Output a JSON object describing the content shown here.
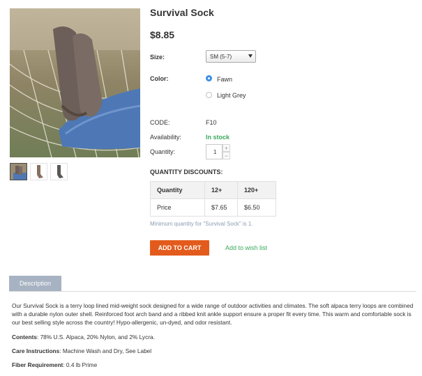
{
  "product": {
    "title": "Survival Sock",
    "price": "$8.85"
  },
  "images": {
    "main": "sock-feet-in-hammock-photo",
    "thumbnails": [
      "thumb-hammock",
      "thumb-sock-brown",
      "thumb-sock-grey"
    ]
  },
  "options": {
    "size_label": "Size:",
    "size_value": "SM (5-7)",
    "color_label": "Color:",
    "colors": [
      "Fawn",
      "Light Grey"
    ],
    "selected_color": "Fawn"
  },
  "info": {
    "code_label": "CODE:",
    "code_value": "F10",
    "availability_label": "Availability:",
    "availability_value": "In stock",
    "quantity_label": "Quantity:",
    "quantity_value": "1",
    "qty_up": "+",
    "qty_down": "−"
  },
  "discounts": {
    "heading": "QUANTITY DISCOUNTS:",
    "header": [
      "Quantity",
      "12+",
      "120+"
    ],
    "row": [
      "Price",
      "$7.65",
      "$6.50"
    ],
    "min_note": "Minimum quantity for \"Survival Sock\" is 1."
  },
  "actions": {
    "add_to_cart": "ADD TO CART",
    "wishlist": "Add to wish list"
  },
  "tabs": {
    "description": "Description"
  },
  "description": {
    "text": "Our Survival Sock is a terry loop lined mid-weight sock designed for a wide range of outdoor activities and climates. The soft alpaca terry loops are combined with a durable nylon outer shell. Reinforced foot arch band and a ribbed knit ankle support ensure a proper fit every time. This warm and comfortable sock is our best selling style across the country! Hypo-allergenic, un-dyed, and odor resistant.",
    "contents_label": "Contents",
    "contents_value": ": 78% U.S. Alpaca, 20% Nylon, and 2% Lycra.",
    "care_label": "Care Instructions",
    "care_value": ": Machine Wash and Dry, See Label",
    "fiber_label": "Fiber Requirement",
    "fiber_value": ": 0.4 lb Prime"
  },
  "colors": {
    "accent_orange": "#e35b1c",
    "stock_green": "#3aaa5c",
    "radio_blue": "#3b8fe6",
    "tab_bg": "#a7b3c2"
  }
}
